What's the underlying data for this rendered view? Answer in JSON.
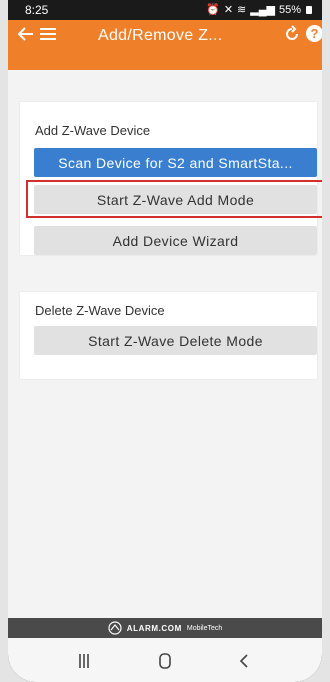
{
  "status_bar": {
    "time": "8:25",
    "battery": "55%"
  },
  "header": {
    "title": "Add/Remove Z...",
    "accent_color": "#f07f2a"
  },
  "add_card": {
    "title": "Add Z-Wave Device",
    "scan_button": "Scan Device for S2 and SmartSta...",
    "start_add_button": "Start Z-Wave Add Mode",
    "wizard_button": "Add Device Wizard"
  },
  "delete_card": {
    "title": "Delete Z-Wave Device",
    "start_delete_button": "Start Z-Wave Delete Mode"
  },
  "footer": {
    "brand": "ALARM.COM",
    "sub": "MobileTech"
  },
  "nav": {
    "recent_icon": "recent-apps-icon",
    "home_icon": "home-icon",
    "back_icon": "back-icon"
  }
}
